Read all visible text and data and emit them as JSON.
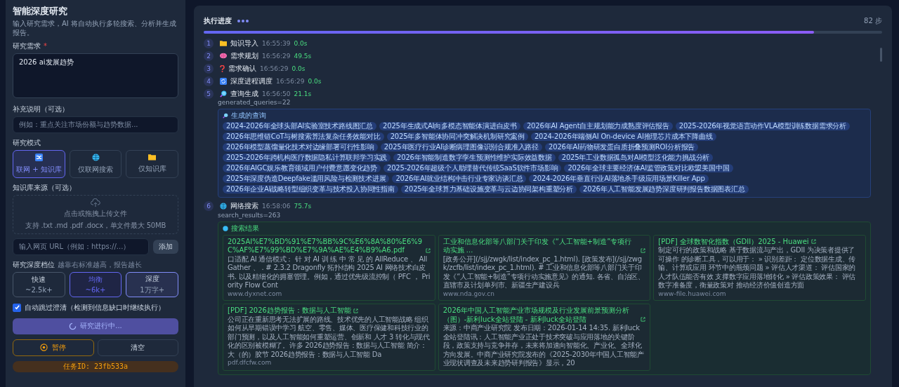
{
  "sidebar": {
    "title": "智能深度研究",
    "subtitle": "输入研究需求，AI 将自动执行多轮搜索、分析并生成报告。",
    "requirement": {
      "label": "研究需求",
      "required_mark": "*",
      "value": "2026 ai发展趋势"
    },
    "notes": {
      "label": "补充说明（可选）",
      "placeholder": "例如：重点关注市场份额与趋势数据..."
    },
    "mode": {
      "label": "研究模式",
      "options": [
        {
          "label": "联网 + 知识库",
          "selected": true
        },
        {
          "label": "仅联网搜索",
          "selected": false
        },
        {
          "label": "仅知识库",
          "selected": false
        }
      ]
    },
    "knowledge": {
      "label": "知识库来源（可选）",
      "upload_title": "点击或拖拽上传文件",
      "upload_hint": "支持 .txt .md .pdf .docx，单文件最大 50MB",
      "url_placeholder": "输入网页 URL（例如：https://...）",
      "add_button": "添加"
    },
    "depth": {
      "label": "研究深度档位",
      "hint": "越靠右标准越高，报告越长",
      "options": [
        {
          "label": "快速",
          "sub": "~2.5k+",
          "selected": false,
          "hovered": false
        },
        {
          "label": "均衡",
          "sub": "~6k+",
          "selected": true,
          "hovered": false
        },
        {
          "label": "深度",
          "sub": "1万字+",
          "selected": false,
          "hovered": true
        }
      ]
    },
    "auto_skip": {
      "label": "自动跳过澄清（检测到信息缺口时继续执行）",
      "checked": true
    },
    "run_button": "研究进行中...",
    "pause_button": "暂停",
    "clear_button": "清空",
    "task_id": "任务ID: 23fb533a"
  },
  "progress": {
    "title": "执行进度",
    "steps_count": "82 步",
    "level": 0.9,
    "steps": [
      {
        "num": "1",
        "name": "知识导入",
        "time": "16:55:39",
        "duration": "0.0s"
      },
      {
        "num": "2",
        "name": "需求规划",
        "time": "16:56:29",
        "duration": "49.5s"
      },
      {
        "num": "3",
        "name": "需求确认",
        "time": "16:56:29",
        "duration": "0.0s"
      },
      {
        "num": "4",
        "name": "深度进程调度",
        "time": "16:56:29",
        "duration": "0.0s"
      },
      {
        "num": "5",
        "name": "查询生成",
        "time": "16:56:50",
        "duration": "21.1s",
        "meta": "generated_queries=22",
        "kind": "queries",
        "box_title": "生成的查询",
        "queries": [
          "2024-2026年全球头部AI实验室技术路线图汇总",
          "2025年生成式AI向多模态智能体演进白皮书",
          "2026年AI Agent自主规划能力成熟度评估报告",
          "2025-2026年视觉语言动作VLA模型训练数据需求分析",
          "2026年思维链CoT与树搜索算法复杂任务效能对比",
          "2025年多智能体协同冲突解决机制研究案例",
          "2024-2026年端侧AI On-device AI推理芯片成本下降曲线",
          "2026年模型蒸馏量化技术对边缘部署可行性影响",
          "2025年医疗行业AI诊断病理图像识别合规准入路径",
          "2026年AI药物研发蛋白质折叠预测ROI分析报告",
          "2025-2026年跨机构医疗数据隐私计算联邦学习实践",
          "2026年智能制造数字孪生预测性维护实际效益数据",
          "2025年工业数据孤岛对AI模型泛化能力挑战分析",
          "2026年AIGC娱乐教育领域用户付费意愿变化趋势",
          "2025-2026年超级个人助理替代传统SaaS软件市场影响",
          "2026年全球主要经济体AI监管政策对比欧盟美国中国",
          "2025年深度伪造Deepfake滥用风险与检测技术进展",
          "2026年AI就业结构冲击行业专家访谈汇总",
          "2024-2026年垂直行业AI落地杀手级应用场景Killer App",
          "2026年企业AI战略转型组织变革与技术投入协同性指南",
          "2025年全球算力基础设施变革与云边协同架构重塑分析",
          "2026年人工智能发展趋势深度研判报告数据图表汇总"
        ]
      },
      {
        "num": "6",
        "name": "网络搜索",
        "time": "16:58:06",
        "duration": "75.7s",
        "meta": "search_results=263",
        "kind": "results",
        "box_title": "搜索结果",
        "results": [
          {
            "title": "2025AI%E7%BD%91%E7%BB%9C%E6%8A%80%E6%9C%AF%E7%99%BD%E7%9A%AE%E4%B9%A6.pdf",
            "snippet": "口适配 AI 通信模式： 针 对 AI 训 练 中 常 见 的 AllReduce 、 AllGather 、 . # 2.3.2 Dragonfly 拓扑结构 2025 AI 网络技术白皮书. 以及精细化的拥塞管理。例如，通过优先级流控制（ PFC ， Priority Flow Cont",
            "url": "www.dyxnet.com"
          },
          {
            "title": "工业和信息化部等八部门关于印发《“人工智能+制造”专项行动实施 ...",
            "snippet": "[政务公开](/sjj/zwgk/list/index_pc_1.html). [政策发布](/sjj/zwgk/zcfb/list/index_pc_1.html). # 工业和信息化部等八部门关于印发《“人工智能+制造”专项行动实施意见》的通知. 各省、自治区、直辖市及计划单列市、新疆生产建设兵",
            "url": "www.nda.gov.cn"
          },
          {
            "title": "[PDF] 全球数智化指数（GDII）2025 - Huawei",
            "snippet": "制定可行的政策和战略 基于数据流与产出，GDII 为决策者提供了可操作 的诊断工具，可以用于： » 识别差距： 定位数据生成、传输、计算或应用 环节中的瓶颈问题 » 评估人才渠道： 评估国家的人才队伍能否有效 支撑数字应用落地转化 » 评估政策效果： 评估数字准备度，衡量政策对 推动经济价值创造方面",
            "url": "www-file.huawei.com"
          },
          {
            "title": "[PDF] 2026趋势报告：数据与人工智能",
            "snippet": "公司正在重新思考无法扩展的路线、技术优先的人工智能战略 组织如何从早期错误中学习 航空、零售、媒体、医疗保健和科技行业的部门预测，以及人工智能如何重塑运营、创新和 人才 3 转化与现代化的区别被模糊了。许多 2026趋势报告：数据与人工智能 简介：大（的）胶节 2026趋势报告：数据与人工智能 Da",
            "url": "pdf.dfcfw.com"
          },
          {
            "title": "2026年中国人工智能产业市场规模及行业发展前景预测分析（图）-新利luck全站登陆 - 新利luck全站登陆",
            "snippet": "来源：中商产业研究院 发布日期：2026-01-14 14:35. 新利luck全站登陆讯：人工智能产业正处于技术突破与应用落地的关键阶段，政策支持与竞争并存，未来将加速向智能化、产业化、全球化方向发展。中商产业研究院发布的《2025-2030年中国人工智能产业现状调查及未来趋势研判报告》显示，20"
          }
        ]
      }
    ]
  }
}
